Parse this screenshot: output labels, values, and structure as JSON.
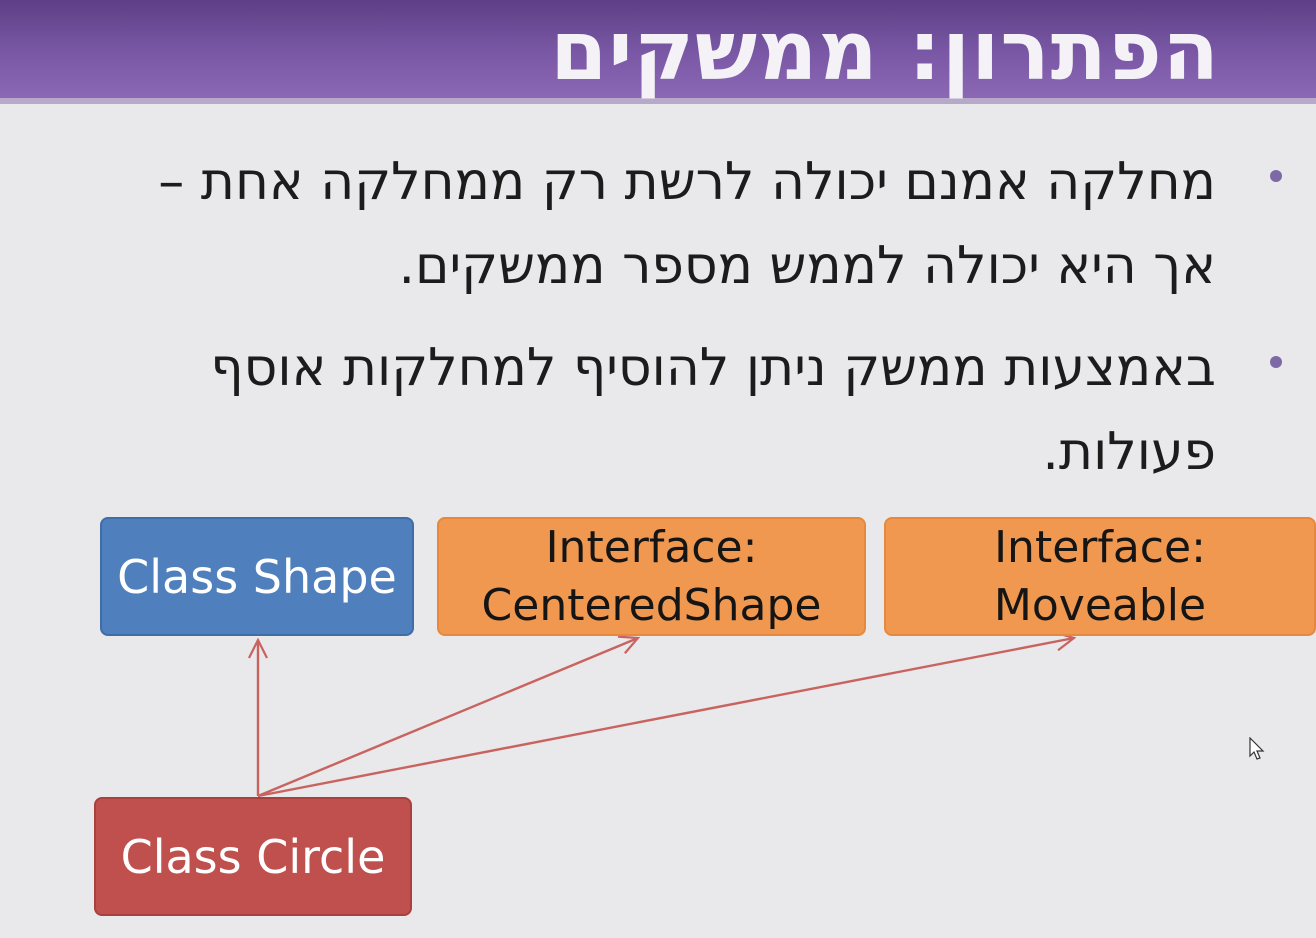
{
  "title": "הפתרון: ממשקים",
  "bullets": [
    "מחלקה אמנם יכולה לרשת רק ממחלקה אחת – אך היא יכולה לממש מספר ממשקים.",
    "באמצעות ממשק ניתן להוסיף למחלקות אוסף פעולות."
  ],
  "diagram": {
    "nodes": {
      "shape": {
        "label": "Class Shape"
      },
      "centered": {
        "line1": "Interface:",
        "line2": "CenteredShape"
      },
      "moveable": {
        "line1": "Interface:",
        "line2": "Moveable"
      },
      "circle": {
        "label": "Class Circle"
      }
    },
    "edges": [
      {
        "from": "circle",
        "to": "shape"
      },
      {
        "from": "circle",
        "to": "centered"
      },
      {
        "from": "circle",
        "to": "moveable"
      }
    ]
  },
  "colors": {
    "title_bar": "#7a58a6",
    "class_box": "#4f80bd",
    "interface_box": "#f0984f",
    "subclass_box": "#c0504d",
    "arrow": "#c0504d",
    "bullet": "#7d69a5"
  }
}
